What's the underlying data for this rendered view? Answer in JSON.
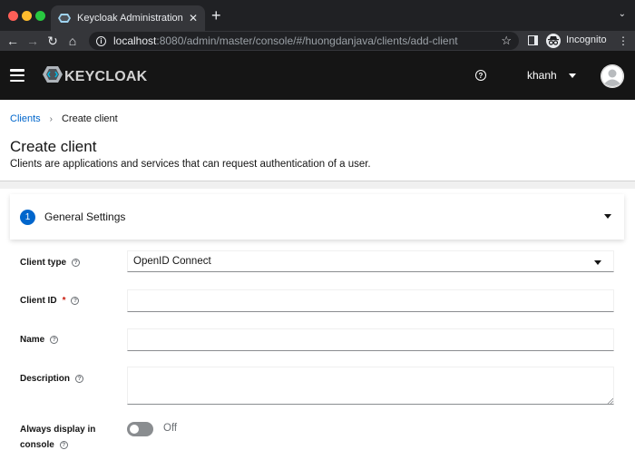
{
  "browser": {
    "tab_title": "Keycloak Administration Conso",
    "tab_close": "✕",
    "new_tab": "+",
    "url_host": "localhost",
    "url_rest": ":8080/admin/master/console/#/huongdanjava/clients/add-client",
    "incognito_label": "Incognito",
    "back_icon": "←",
    "forward_icon": "→",
    "reload_icon": "↻",
    "home_icon": "⌂",
    "star_icon": "☆",
    "tab_menu_icon": "⌄",
    "kebab_icon": "⋮"
  },
  "masthead": {
    "brand": "KEYCLOAK",
    "help_icon": "?",
    "username": "khanh",
    "brand_color": "#d2d2d2"
  },
  "breadcrumb": {
    "parent": "Clients",
    "separator": "›",
    "current": "Create client"
  },
  "page": {
    "title": "Create client",
    "description": "Clients are applications and services that can request authentication of a user."
  },
  "wizard": {
    "step_number": "1",
    "step_label": "General Settings",
    "accent_color": "#0066cc"
  },
  "form": {
    "client_type": {
      "label": "Client type",
      "value": "OpenID Connect"
    },
    "client_id": {
      "label": "Client ID",
      "required_mark": "*",
      "value": ""
    },
    "name": {
      "label": "Name",
      "value": ""
    },
    "description": {
      "label": "Description",
      "value": ""
    },
    "always_display": {
      "label_line1": "Always display in",
      "label_line2": "console",
      "state_label": "Off"
    },
    "help_icon": "?"
  }
}
